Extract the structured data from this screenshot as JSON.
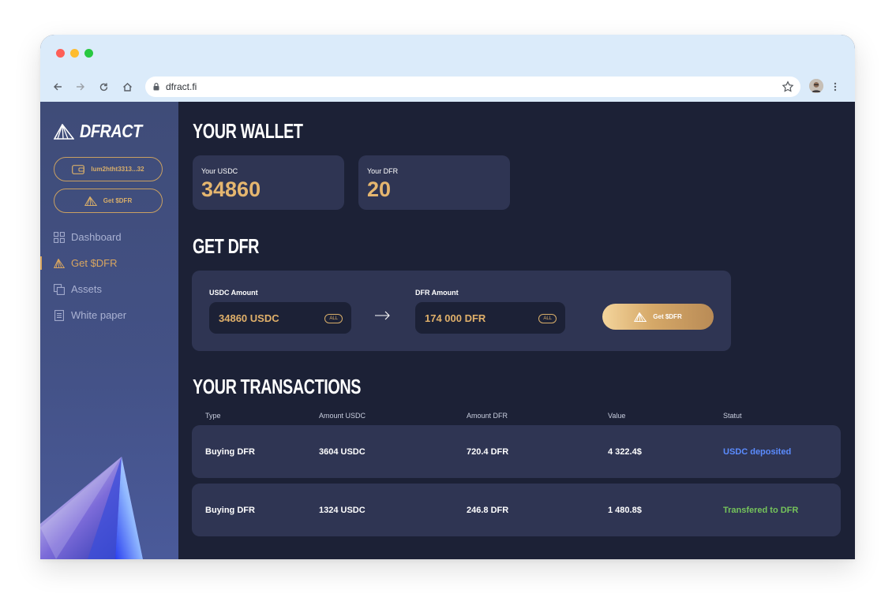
{
  "browser": {
    "url": "dfract.fi",
    "icons": [
      "back-icon",
      "forward-icon",
      "reload-icon",
      "home-icon",
      "lock-icon",
      "star-icon",
      "avatar",
      "kebab-icon"
    ]
  },
  "sidebar": {
    "logo": "DFRACT",
    "wallet_address": "lum2htht3313...32",
    "get_button": "Get $DFR",
    "items": [
      {
        "label": "Dashboard",
        "icon": "dashboard-icon"
      },
      {
        "label": "Get $DFR",
        "icon": "dfract-logo-icon",
        "active": true
      },
      {
        "label": "Assets",
        "icon": "assets-icon"
      },
      {
        "label": "White paper",
        "icon": "document-icon"
      }
    ]
  },
  "wallet": {
    "title": "YOUR WALLET",
    "cards": [
      {
        "label": "Your USDC",
        "value": "34860"
      },
      {
        "label": "Your DFR",
        "value": "20"
      }
    ]
  },
  "get_dfr": {
    "title": "GET DFR",
    "usdc_label": "USDC Amount",
    "usdc_value": "34860 USDC",
    "dfr_label": "DFR Amount",
    "dfr_value": "174 000 DFR",
    "all_label": "ALL",
    "button": "Get $DFR"
  },
  "transactions": {
    "title": "YOUR TRANSACTIONS",
    "columns": [
      "Type",
      "Amount USDC",
      "Amount DFR",
      "Value",
      "Statut"
    ],
    "rows": [
      {
        "type": "Buying DFR",
        "usdc": "3604 USDC",
        "dfr": "720.4 DFR",
        "value": "4 322.4$",
        "status": "USDC deposited"
      },
      {
        "type": "Buying DFR",
        "usdc": "1324 USDC",
        "dfr": "246.8 DFR",
        "value": "1 480.8$",
        "status": "Transfered to DFR"
      }
    ]
  },
  "colors": {
    "accent_gold": "#e5b66f",
    "status_blue": "#5b8cff",
    "status_green": "#75c45b",
    "background": "#1c2136",
    "card": "#2f3553"
  }
}
